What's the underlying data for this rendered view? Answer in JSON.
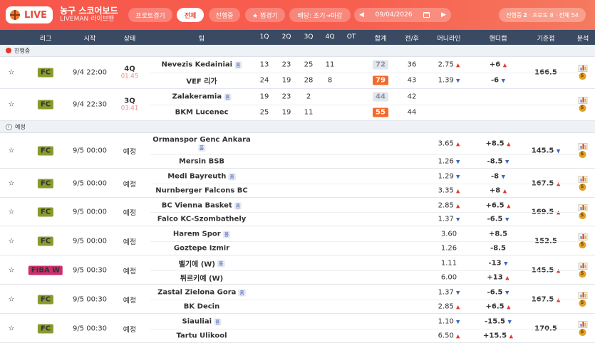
{
  "header": {
    "live_label": "LIVE",
    "title": "농구 스코어보드",
    "subtitle": "LIVEMAN 라이브맨",
    "filters": [
      {
        "label": "프로토경기",
        "active": false
      },
      {
        "label": "전체",
        "active": true
      },
      {
        "label": "진행중",
        "active": false
      },
      {
        "label": "★ 찜경기",
        "active": false
      },
      {
        "label": "배당: 초기→마감",
        "active": false
      }
    ],
    "date": "09/04/2026",
    "prev_arrow": "◀",
    "next_arrow": "▶",
    "status": {
      "live_label": "진행중",
      "live_count": "2",
      "proto_label": "프로토",
      "proto_count": "8",
      "total_label": "전체",
      "total_count": "54"
    }
  },
  "columns": [
    "리그",
    "시작",
    "상태",
    "팀",
    "1Q",
    "2Q",
    "3Q",
    "4Q",
    "OT",
    "합계",
    "전/후",
    "머니라인",
    "핸디캡",
    "기준점",
    "분석"
  ],
  "sections": {
    "live": "진행중",
    "upcoming": "예정"
  },
  "colors": {
    "accent": "#f7574a",
    "header_bg": "#3b4a63",
    "league_fc": "#8a9a2e",
    "league_fiba": "#cc2f6e",
    "total_live": "#f56a2b"
  },
  "live_matches": [
    {
      "league": "FC",
      "start": "9/4 22:00",
      "quarter": "4Q",
      "clock": "01:45",
      "base": "166.5",
      "base_dir": "",
      "home": {
        "name": "Nevezis Kedainiai",
        "tag": "홈",
        "q": [
          "13",
          "23",
          "25",
          "11"
        ],
        "total": "72",
        "half": "36",
        "ml": "2.75",
        "ml_dir": "up",
        "hc": "+6",
        "hc_dir": "up"
      },
      "away": {
        "name": "VEF 리가",
        "q": [
          "24",
          "19",
          "28",
          "8"
        ],
        "total": "79",
        "half": "43",
        "ml": "1.39",
        "ml_dir": "down",
        "hc": "-6",
        "hc_dir": "down"
      }
    },
    {
      "league": "FC",
      "start": "9/4 22:30",
      "quarter": "3Q",
      "clock": "03:41",
      "base": "",
      "base_dir": "",
      "home": {
        "name": "Zalakeramia",
        "tag": "홈",
        "q": [
          "19",
          "23",
          "2",
          ""
        ],
        "total": "44",
        "half": "42",
        "ml": "",
        "ml_dir": "",
        "hc": "",
        "hc_dir": ""
      },
      "away": {
        "name": "BKM Lucenec",
        "q": [
          "25",
          "19",
          "11",
          ""
        ],
        "total": "55",
        "half": "44",
        "ml": "",
        "ml_dir": "",
        "hc": "",
        "hc_dir": ""
      }
    }
  ],
  "upcoming_matches": [
    {
      "league": "FC",
      "start": "9/5 00:00",
      "state": "예정",
      "base": "145.5",
      "base_dir": "down",
      "home": {
        "name": "Ormanspor Genc Ankara",
        "tag": "홈",
        "ml": "3.65",
        "ml_dir": "up",
        "hc": "+8.5",
        "hc_dir": "up"
      },
      "away": {
        "name": "Mersin BSB",
        "ml": "1.26",
        "ml_dir": "down",
        "hc": "-8.5",
        "hc_dir": "down"
      }
    },
    {
      "league": "FC",
      "start": "9/5 00:00",
      "state": "예정",
      "base": "167.5",
      "base_dir": "up",
      "home": {
        "name": "Medi Bayreuth",
        "tag": "홈",
        "ml": "1.29",
        "ml_dir": "down",
        "hc": "-8",
        "hc_dir": "down"
      },
      "away": {
        "name": "Nurnberger Falcons BC",
        "ml": "3.35",
        "ml_dir": "up",
        "hc": "+8",
        "hc_dir": "up"
      }
    },
    {
      "league": "FC",
      "start": "9/5 00:00",
      "state": "예정",
      "base": "169.5",
      "base_dir": "up",
      "home": {
        "name": "BC Vienna Basket",
        "tag": "홈",
        "ml": "2.85",
        "ml_dir": "up",
        "hc": "+6.5",
        "hc_dir": "up"
      },
      "away": {
        "name": "Falco KC-Szombathely",
        "ml": "1.37",
        "ml_dir": "down",
        "hc": "-6.5",
        "hc_dir": "down"
      }
    },
    {
      "league": "FC",
      "start": "9/5 00:00",
      "state": "예정",
      "base": "152.5",
      "base_dir": "",
      "home": {
        "name": "Harem Spor",
        "tag": "홈",
        "ml": "3.60",
        "ml_dir": "",
        "hc": "+8.5",
        "hc_dir": ""
      },
      "away": {
        "name": "Goztepe Izmir",
        "ml": "1.26",
        "ml_dir": "",
        "hc": "-8.5",
        "hc_dir": ""
      }
    },
    {
      "league": "FIBA W",
      "start": "9/5 00:30",
      "state": "예정",
      "base": "145.5",
      "base_dir": "up",
      "home": {
        "name": "벨기에 (W)",
        "tag": "홈",
        "ml": "1.11",
        "ml_dir": "",
        "hc": "-13",
        "hc_dir": "down"
      },
      "away": {
        "name": "튀르키예 (W)",
        "ml": "6.00",
        "ml_dir": "",
        "hc": "+13",
        "hc_dir": "up"
      }
    },
    {
      "league": "FC",
      "start": "9/5 00:30",
      "state": "예정",
      "base": "167.5",
      "base_dir": "up",
      "home": {
        "name": "Zastal Zielona Gora",
        "tag": "홈",
        "ml": "1.37",
        "ml_dir": "down",
        "hc": "-6.5",
        "hc_dir": "down"
      },
      "away": {
        "name": "BK Decin",
        "ml": "2.85",
        "ml_dir": "up",
        "hc": "+6.5",
        "hc_dir": "up"
      }
    },
    {
      "league": "FC",
      "start": "9/5 00:30",
      "state": "예정",
      "base": "170.5",
      "base_dir": "",
      "home": {
        "name": "Siauliai",
        "tag": "홈",
        "ml": "1.10",
        "ml_dir": "down",
        "hc": "-15.5",
        "hc_dir": "down"
      },
      "away": {
        "name": "Tartu Ulikool",
        "ml": "6.50",
        "ml_dir": "up",
        "hc": "+15.5",
        "hc_dir": "up"
      }
    }
  ]
}
